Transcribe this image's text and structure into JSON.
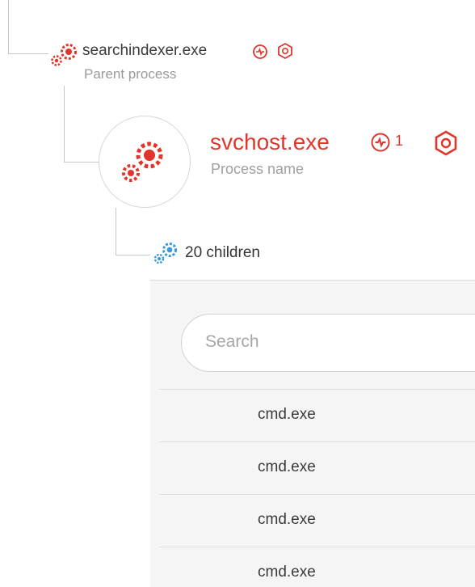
{
  "parent": {
    "name": "searchindexer.exe",
    "label": "Parent process",
    "icon": "gears-icon"
  },
  "process": {
    "name": "svchost.exe",
    "label": "Process name",
    "activity_count": "1",
    "icon": "gears-icon"
  },
  "children": {
    "label": "20 children",
    "search": {
      "placeholder": "Search"
    },
    "rows": [
      {
        "name": "cmd.exe"
      },
      {
        "name": "cmd.exe"
      },
      {
        "name": "cmd.exe"
      },
      {
        "name": "cmd.exe"
      }
    ]
  },
  "colors": {
    "accent_red": "#e0352b",
    "children_blue": "#3a9ad9"
  }
}
